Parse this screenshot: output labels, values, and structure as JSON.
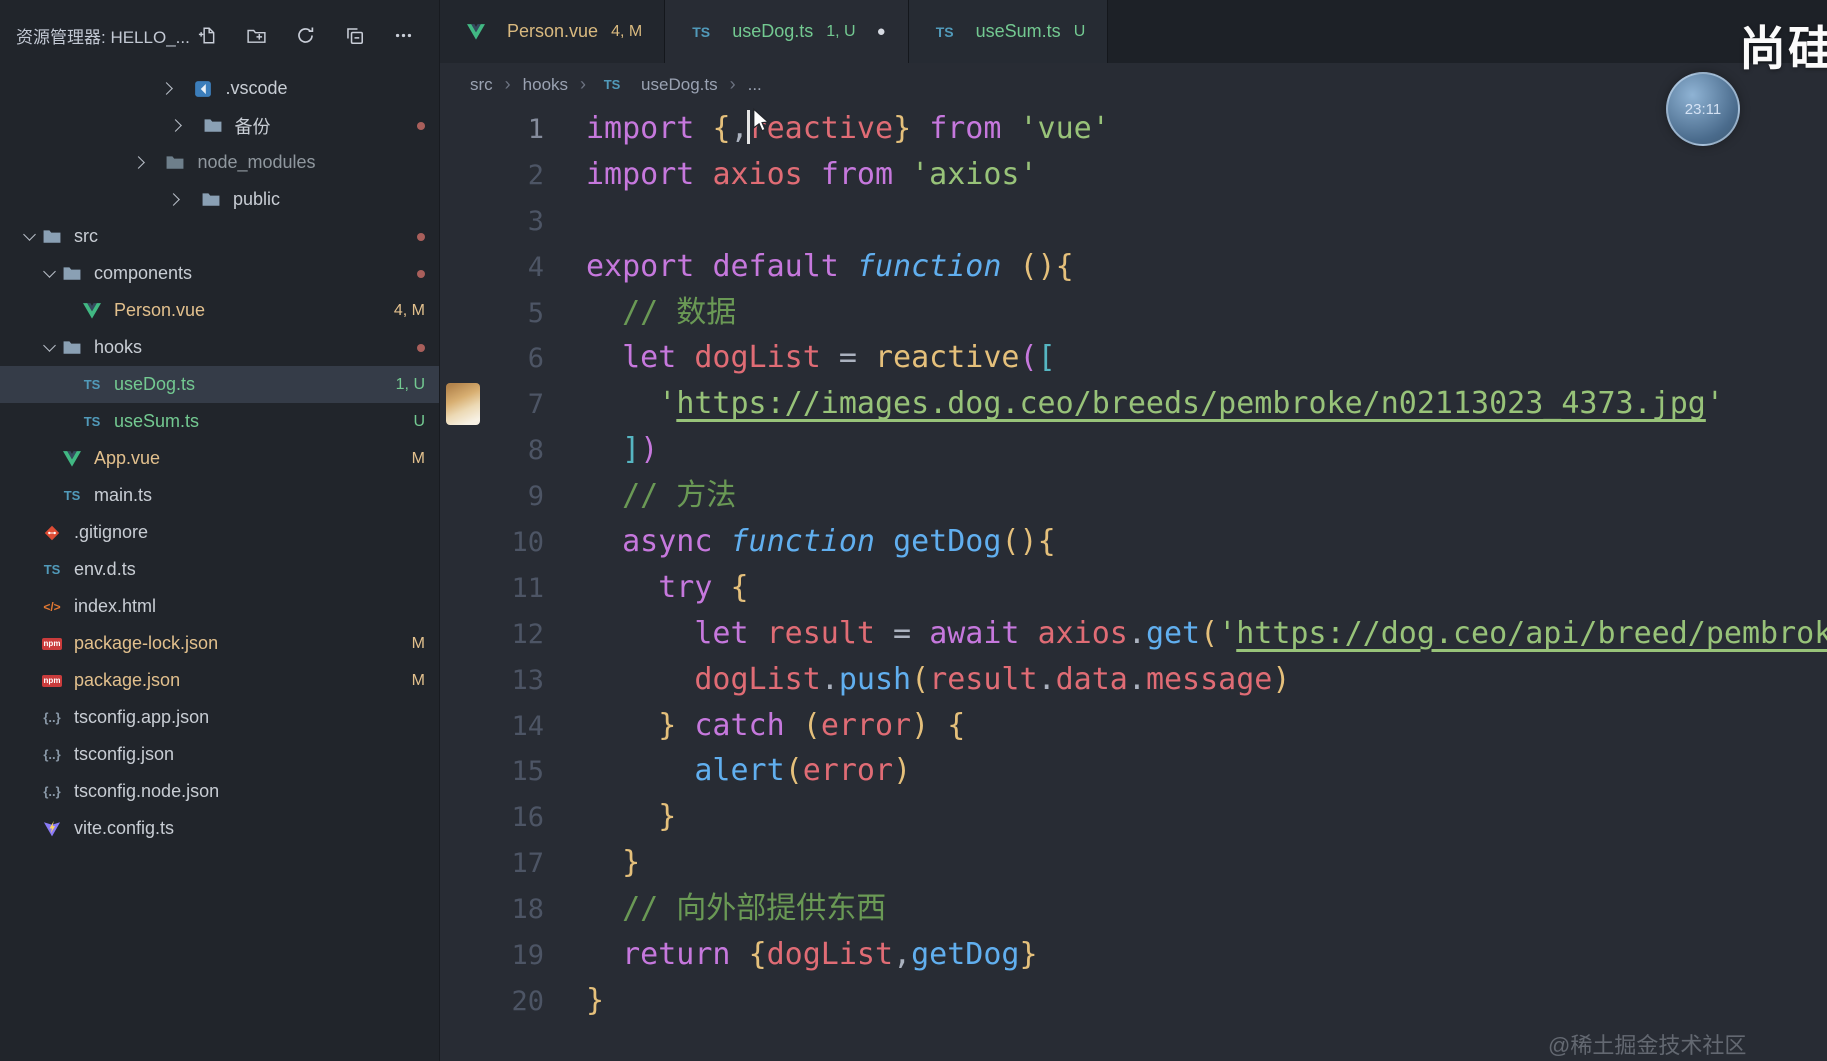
{
  "colors": {
    "editor_bg": "#282c34",
    "sidebar_bg": "#21252b",
    "tabbar_bg": "#1d2127",
    "selection_bg": "#353c48",
    "git_modified": "#e2c08d",
    "git_untracked": "#73c991",
    "folder_change_dot": "#a95f5b"
  },
  "explorer": {
    "title": "资源管理器: HELLO_...",
    "actions": [
      "new-file",
      "new-folder",
      "refresh",
      "collapse-folders",
      "more-actions"
    ],
    "items": [
      {
        "label": ".vscode",
        "icon": "vscode",
        "indent": 0,
        "chevron": "right"
      },
      {
        "label": "备份",
        "icon": "folder",
        "indent": 0,
        "chevron": "right",
        "dot": true
      },
      {
        "label": "node_modules",
        "icon": "folder-dim",
        "indent": 0,
        "chevron": "right",
        "state": "dim"
      },
      {
        "label": "public",
        "icon": "folder",
        "indent": 0,
        "chevron": "right"
      },
      {
        "label": "src",
        "icon": "folder",
        "indent": 0,
        "chevron": "down",
        "dot": true
      },
      {
        "label": "components",
        "icon": "folder",
        "indent": 1,
        "chevron": "down",
        "dot": true
      },
      {
        "label": "Person.vue",
        "icon": "vue",
        "indent": 2,
        "badge": "4, M",
        "state": "modified"
      },
      {
        "label": "hooks",
        "icon": "folder",
        "indent": 1,
        "chevron": "down",
        "dot": true
      },
      {
        "label": "useDog.ts",
        "icon": "ts",
        "indent": 2,
        "badge": "1, U",
        "state": "untracked",
        "selected": true
      },
      {
        "label": "useSum.ts",
        "icon": "ts",
        "indent": 2,
        "badge": "U",
        "state": "untracked"
      },
      {
        "label": "App.vue",
        "icon": "vue",
        "indent": 1,
        "badge": "M",
        "state": "modified"
      },
      {
        "label": "main.ts",
        "icon": "ts",
        "indent": 1
      },
      {
        "label": ".gitignore",
        "icon": "git",
        "indent": 0
      },
      {
        "label": "env.d.ts",
        "icon": "ts",
        "indent": 0
      },
      {
        "label": "index.html",
        "icon": "html",
        "indent": 0
      },
      {
        "label": "package-lock.json",
        "icon": "npm",
        "indent": 0,
        "badge": "M",
        "state": "modified"
      },
      {
        "label": "package.json",
        "icon": "npm",
        "indent": 0,
        "badge": "M",
        "state": "modified"
      },
      {
        "label": "tsconfig.app.json",
        "icon": "json",
        "indent": 0
      },
      {
        "label": "tsconfig.json",
        "icon": "json",
        "indent": 0
      },
      {
        "label": "tsconfig.node.json",
        "icon": "json",
        "indent": 0
      },
      {
        "label": "vite.config.ts",
        "icon": "vite",
        "indent": 0
      }
    ]
  },
  "tabs": [
    {
      "label": "Person.vue",
      "sublabel": "4, M",
      "icon": "vue",
      "state": "modified",
      "active": false,
      "dirty": false
    },
    {
      "label": "useDog.ts",
      "sublabel": "1, U",
      "icon": "ts",
      "state": "untracked",
      "active": true,
      "dirty": true
    },
    {
      "label": "useSum.ts",
      "sublabel": "U",
      "icon": "ts",
      "state": "untracked",
      "active": false,
      "dirty": false
    }
  ],
  "breadcrumb": {
    "items": [
      {
        "label": "src"
      },
      {
        "label": "hooks"
      },
      {
        "label": "useDog.ts",
        "icon": "ts"
      },
      {
        "label": "..."
      }
    ]
  },
  "code": {
    "active_line": 1,
    "colors": {
      "kw": "#c678dd",
      "fnkw": "#61afef",
      "fn": "#61afef",
      "callY": "#e5c07b",
      "var": "#e06c75",
      "id": "#abb2bf",
      "str": "#98c379",
      "strU": "#98c379",
      "cm": "#6a9955",
      "br1": "#e5c07b",
      "br2": "#c678dd",
      "br3": "#56b6c2"
    },
    "lines": [
      {
        "n": 1,
        "tokens": [
          [
            "kw",
            "import "
          ],
          [
            "br1",
            "{"
          ],
          [
            "id",
            ","
          ],
          [
            "caret",
            ""
          ],
          [
            "var",
            "reactive"
          ],
          [
            "br1",
            "}"
          ],
          [
            "id",
            " "
          ],
          [
            "kw",
            "from"
          ],
          [
            "id",
            " "
          ],
          [
            "str",
            "'vue'"
          ]
        ]
      },
      {
        "n": 2,
        "tokens": [
          [
            "kw",
            "import "
          ],
          [
            "var",
            "axios"
          ],
          [
            "id",
            " "
          ],
          [
            "kw",
            "from"
          ],
          [
            "id",
            " "
          ],
          [
            "str",
            "'axios'"
          ]
        ]
      },
      {
        "n": 3,
        "tokens": []
      },
      {
        "n": 4,
        "tokens": [
          [
            "kw",
            "export "
          ],
          [
            "kw",
            "default "
          ],
          [
            "fnkw",
            "function "
          ],
          [
            "br1",
            "()"
          ],
          [
            "br1",
            "{"
          ]
        ]
      },
      {
        "n": 5,
        "tokens": [
          [
            "id",
            "  "
          ],
          [
            "cm",
            "// 数据"
          ]
        ]
      },
      {
        "n": 6,
        "tokens": [
          [
            "id",
            "  "
          ],
          [
            "kw",
            "let "
          ],
          [
            "var",
            "dogList"
          ],
          [
            "id",
            " = "
          ],
          [
            "callY",
            "reactive"
          ],
          [
            "br2",
            "("
          ],
          [
            "br3",
            "["
          ]
        ]
      },
      {
        "n": 7,
        "thumb": true,
        "tokens": [
          [
            "id",
            "    "
          ],
          [
            "str",
            "'"
          ],
          [
            "strU",
            "https://images.dog.ceo/breeds/pembroke/n02113023_4373.jpg"
          ],
          [
            "str",
            "'"
          ]
        ]
      },
      {
        "n": 8,
        "tokens": [
          [
            "id",
            "  "
          ],
          [
            "br3",
            "]"
          ],
          [
            "br2",
            ")"
          ]
        ]
      },
      {
        "n": 9,
        "tokens": [
          [
            "id",
            "  "
          ],
          [
            "cm",
            "// 方法"
          ]
        ]
      },
      {
        "n": 10,
        "tokens": [
          [
            "id",
            "  "
          ],
          [
            "kw",
            "async "
          ],
          [
            "fnkw",
            "function "
          ],
          [
            "fn",
            "getDog"
          ],
          [
            "br1",
            "()"
          ],
          [
            "br1",
            "{"
          ]
        ]
      },
      {
        "n": 11,
        "tokens": [
          [
            "id",
            "    "
          ],
          [
            "kw",
            "try "
          ],
          [
            "br1",
            "{"
          ]
        ]
      },
      {
        "n": 12,
        "tokens": [
          [
            "id",
            "      "
          ],
          [
            "kw",
            "let "
          ],
          [
            "var",
            "result"
          ],
          [
            "id",
            " = "
          ],
          [
            "kw",
            "await "
          ],
          [
            "var",
            "axios"
          ],
          [
            "id",
            "."
          ],
          [
            "fn",
            "get"
          ],
          [
            "br1",
            "("
          ],
          [
            "str",
            "'"
          ],
          [
            "strU",
            "https://dog.ceo/api/breed/pembroke/images/random"
          ],
          [
            "str",
            "'"
          ],
          [
            "br1",
            ")"
          ]
        ]
      },
      {
        "n": 13,
        "tokens": [
          [
            "id",
            "      "
          ],
          [
            "var",
            "dogList"
          ],
          [
            "id",
            "."
          ],
          [
            "fn",
            "push"
          ],
          [
            "br1",
            "("
          ],
          [
            "var",
            "result"
          ],
          [
            "id",
            "."
          ],
          [
            "var",
            "data"
          ],
          [
            "id",
            "."
          ],
          [
            "var",
            "message"
          ],
          [
            "br1",
            ")"
          ]
        ]
      },
      {
        "n": 14,
        "tokens": [
          [
            "id",
            "    "
          ],
          [
            "br1",
            "} "
          ],
          [
            "kw",
            "catch "
          ],
          [
            "br1",
            "("
          ],
          [
            "var",
            "error"
          ],
          [
            "br1",
            ")"
          ],
          [
            "id",
            " "
          ],
          [
            "br1",
            "{"
          ]
        ]
      },
      {
        "n": 15,
        "tokens": [
          [
            "id",
            "      "
          ],
          [
            "fn",
            "alert"
          ],
          [
            "br1",
            "("
          ],
          [
            "var",
            "error"
          ],
          [
            "br1",
            ")"
          ]
        ]
      },
      {
        "n": 16,
        "tokens": [
          [
            "id",
            "    "
          ],
          [
            "br1",
            "}"
          ]
        ]
      },
      {
        "n": 17,
        "tokens": [
          [
            "id",
            "  "
          ],
          [
            "br1",
            "}"
          ]
        ]
      },
      {
        "n": 18,
        "tokens": [
          [
            "id",
            "  "
          ],
          [
            "cm",
            "// 向外部提供东西"
          ]
        ]
      },
      {
        "n": 19,
        "tokens": [
          [
            "id",
            "  "
          ],
          [
            "kw",
            "return "
          ],
          [
            "br1",
            "{"
          ],
          [
            "var",
            "dogList"
          ],
          [
            "id",
            ","
          ],
          [
            "fn",
            "getDog"
          ],
          [
            "br1",
            "}"
          ]
        ]
      },
      {
        "n": 20,
        "tokens": [
          [
            "br1",
            "}"
          ]
        ]
      }
    ]
  },
  "watermarks": {
    "brand": "尚硅谷",
    "clock_time": "23:11",
    "community": "@稀土掘金技术社区"
  }
}
